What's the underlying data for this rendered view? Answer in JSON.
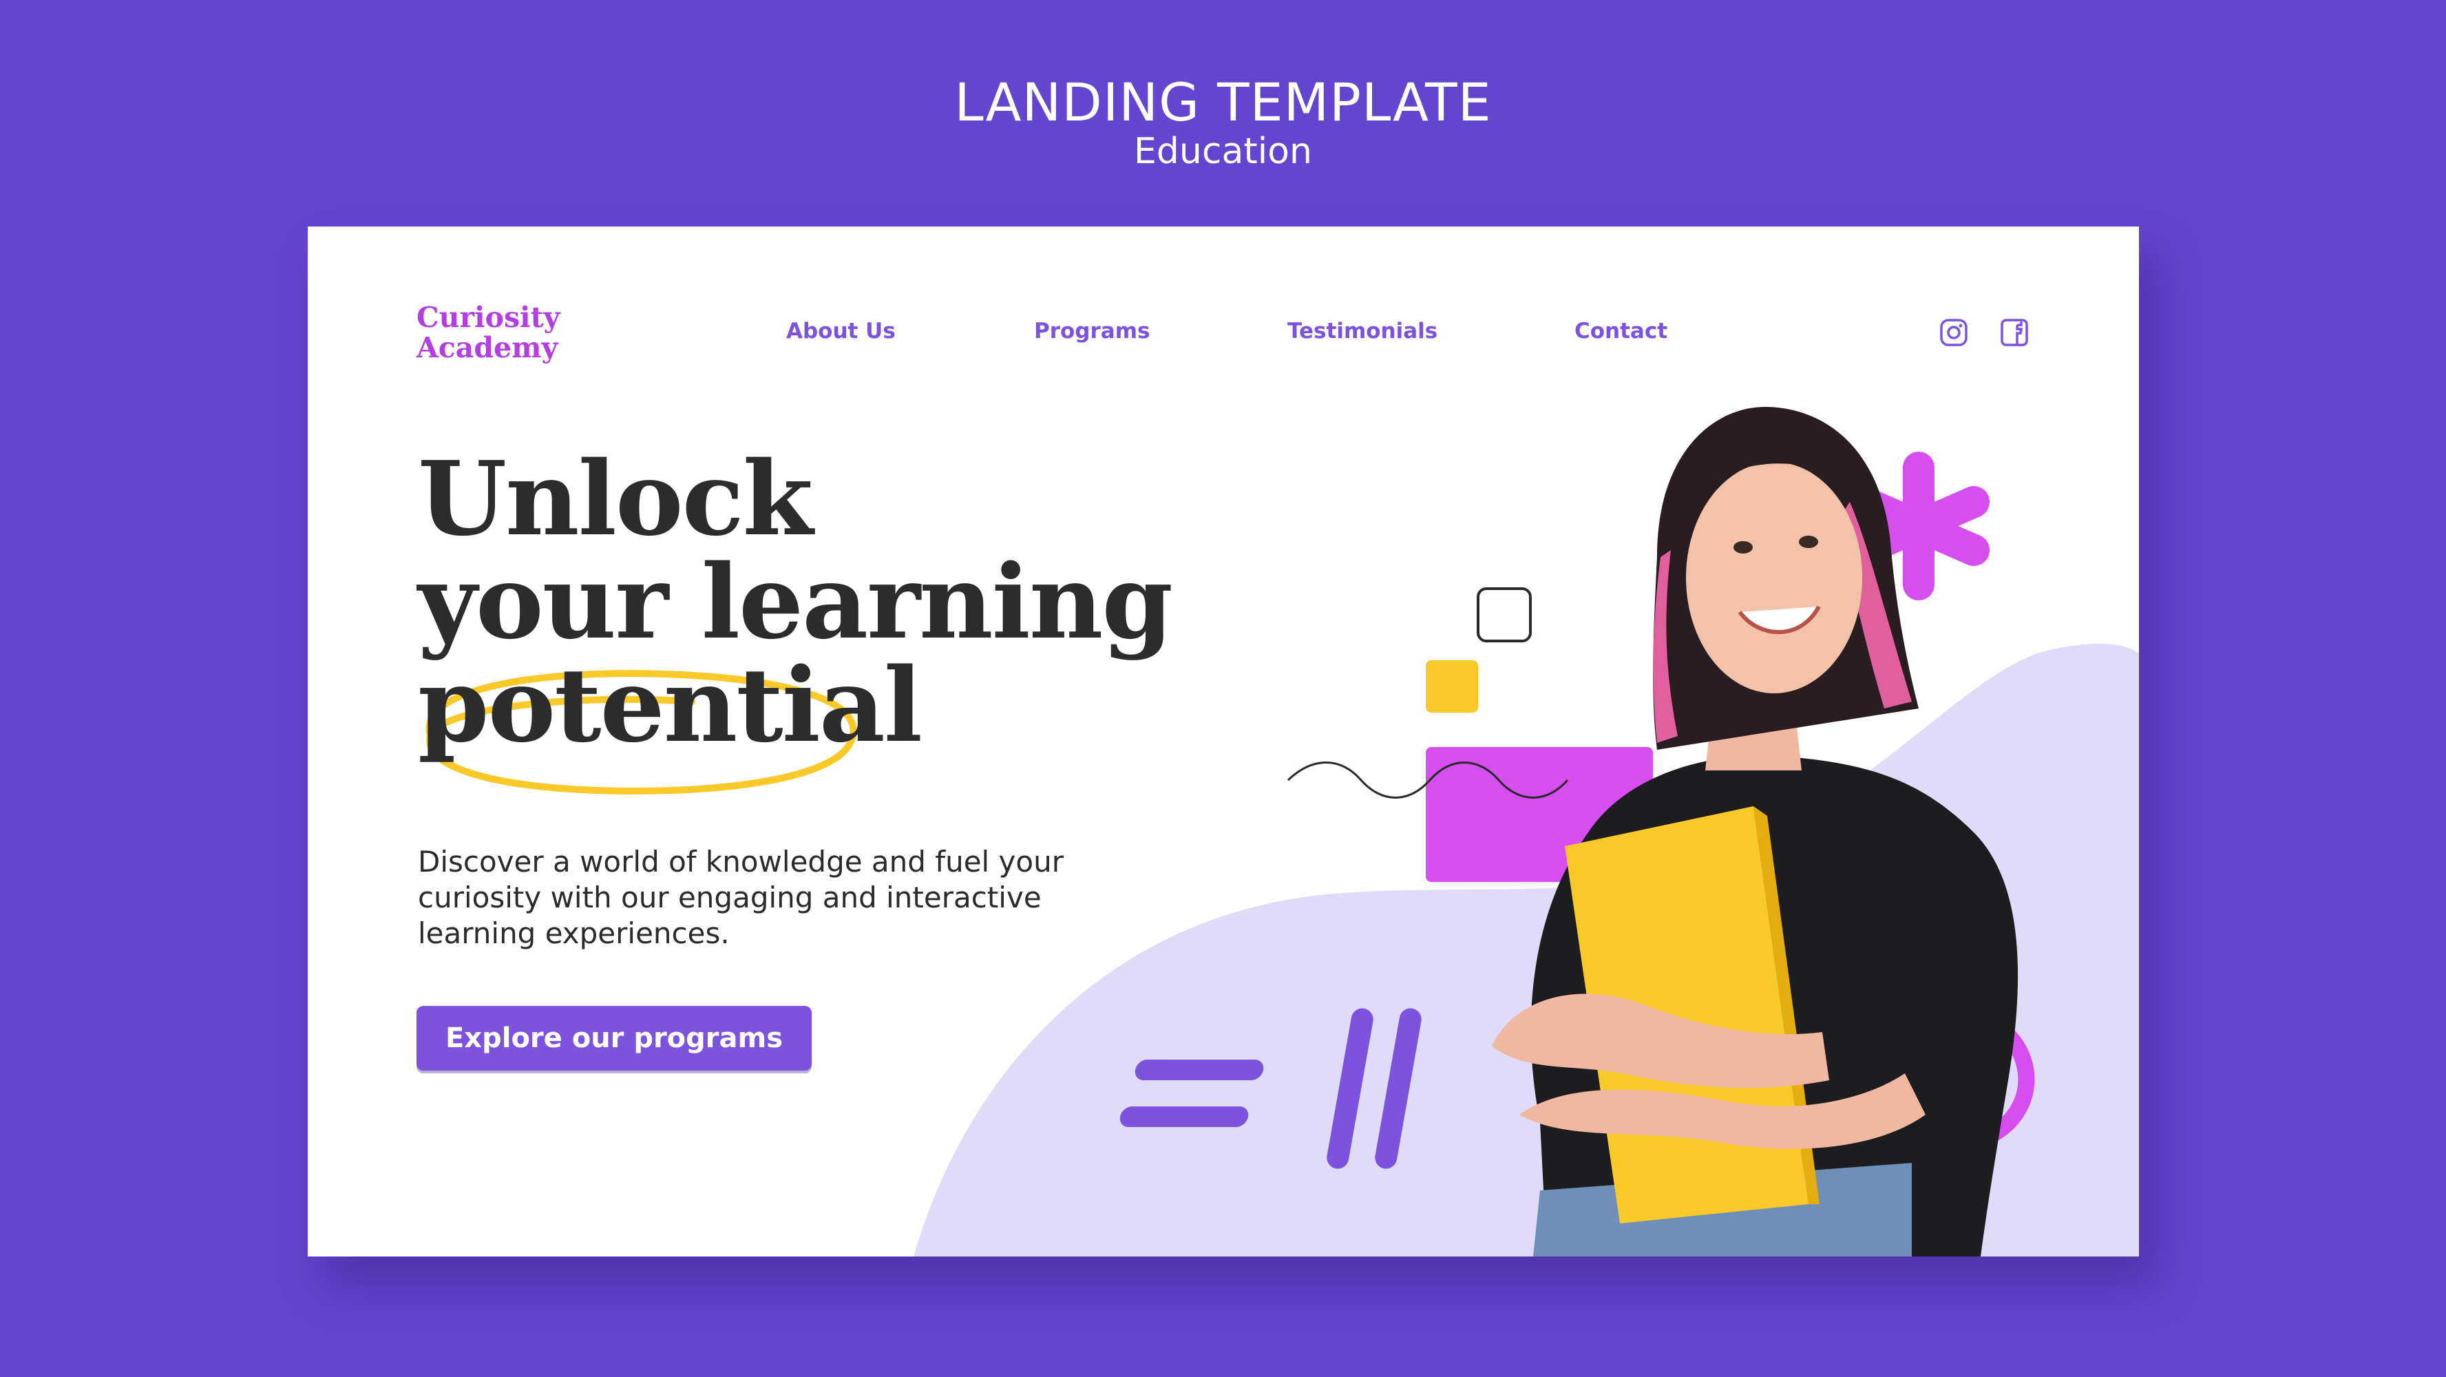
{
  "page": {
    "title": "LANDING TEMPLATE",
    "subtitle": "Education"
  },
  "brand": {
    "line1": "Curiosity",
    "line2": "Academy"
  },
  "nav": {
    "items": [
      {
        "label": "About Us"
      },
      {
        "label": "Programs"
      },
      {
        "label": "Testimonials"
      },
      {
        "label": "Contact"
      }
    ]
  },
  "social": {
    "icons": [
      "instagram-icon",
      "facebook-icon"
    ]
  },
  "hero": {
    "headline_line1": "Unlock",
    "headline_line2": "your learning",
    "headline_line3": "potential",
    "description": "Discover a world of knowledge and fuel your curiosity with our engaging and interactive learning experiences.",
    "cta_label": "Explore our programs"
  },
  "colors": {
    "background": "#6445cf",
    "brand": "#b43fe0",
    "nav": "#7b53dd",
    "accent_yellow": "#f8c928",
    "lavender": "#dfdbf9",
    "magenta": "#d64ef0"
  }
}
